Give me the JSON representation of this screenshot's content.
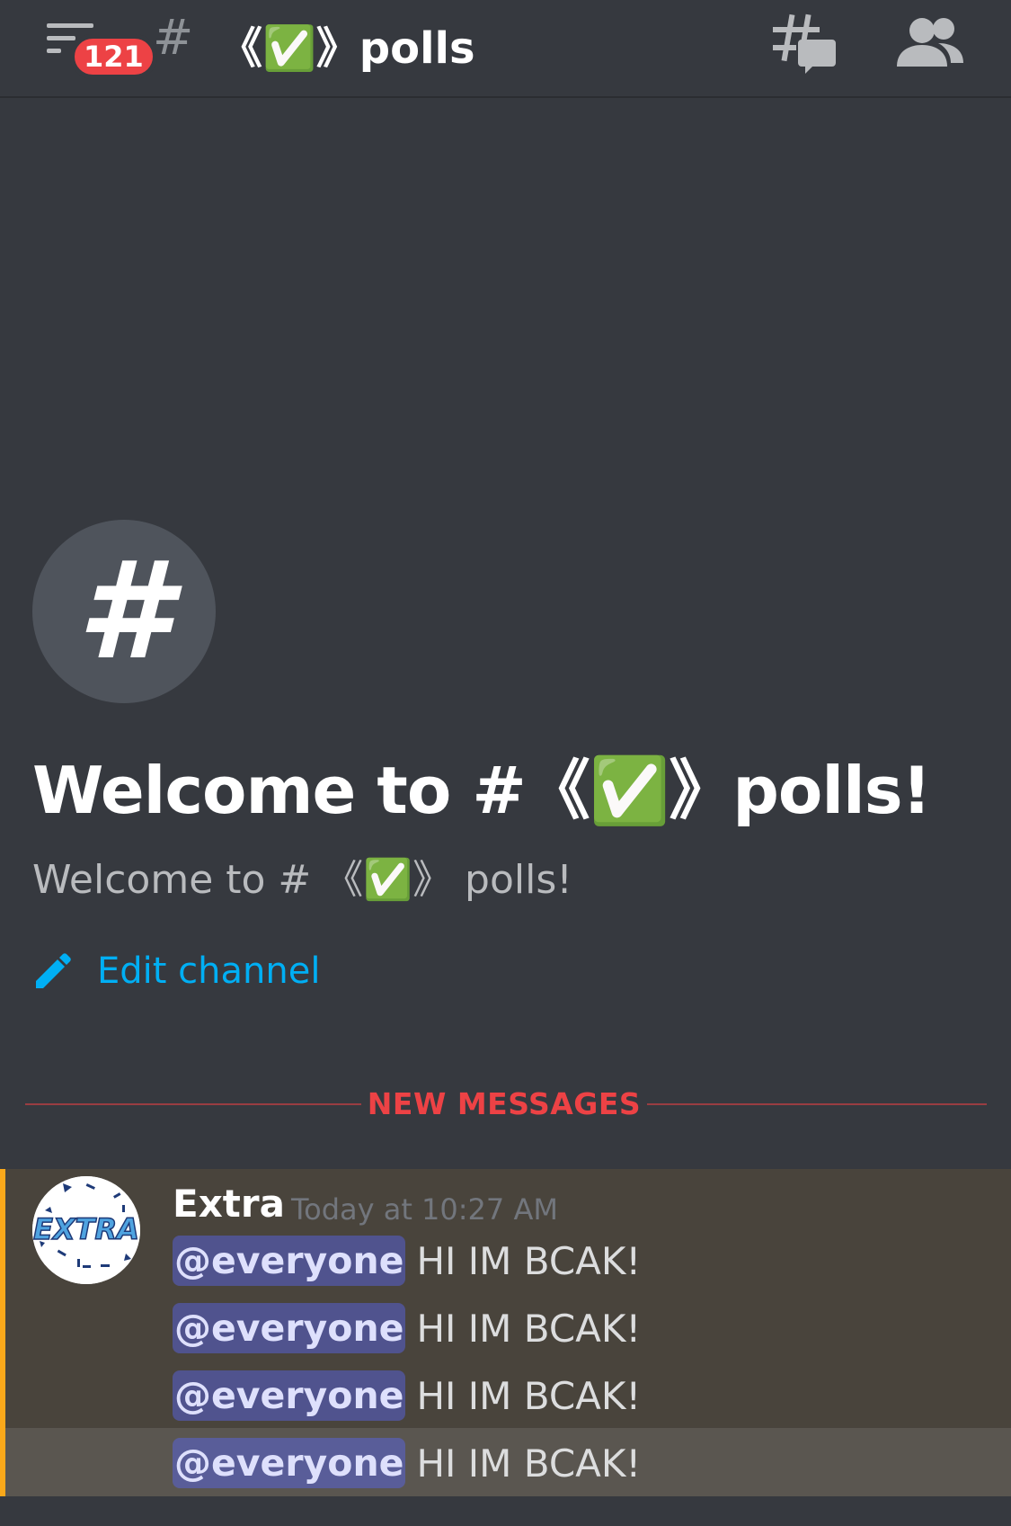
{
  "header": {
    "unread_count": "121",
    "hash": "#",
    "channel_name": "《✅》polls"
  },
  "intro": {
    "icon_glyph": "#",
    "title": "Welcome to #《✅》polls!",
    "subtitle": "Welcome to # 《✅》 polls!",
    "edit_label": "Edit channel"
  },
  "divider": {
    "label": "NEW MESSAGES"
  },
  "message_group": {
    "username": "Extra",
    "timestamp": "Today at 10:27 AM",
    "avatar_text": "EXTRA",
    "messages": [
      {
        "mention": "@everyone",
        "text": "HI IM BCAK!"
      },
      {
        "mention": "@everyone",
        "text": "HI IM BCAK!"
      },
      {
        "mention": "@everyone",
        "text": "HI IM BCAK!"
      },
      {
        "mention": "@everyone",
        "text": "HI IM BCAK!"
      }
    ]
  },
  "colors": {
    "background": "#36393f",
    "badge": "#ed4245",
    "link": "#00aff4",
    "mention_bg": "#5865f2",
    "highlight_accent": "#faa81a"
  }
}
